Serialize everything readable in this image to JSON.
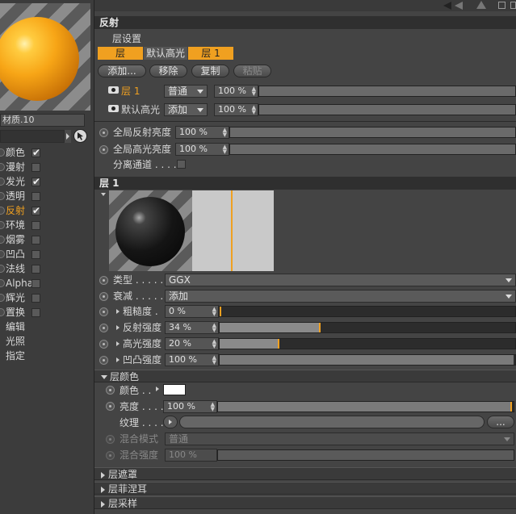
{
  "material_name": "材质.10",
  "channels": [
    {
      "label": "颜色",
      "checked": true,
      "active": false,
      "has_checkbox": true
    },
    {
      "label": "漫射",
      "checked": false,
      "active": false,
      "has_checkbox": true
    },
    {
      "label": "发光",
      "checked": true,
      "active": false,
      "has_checkbox": true
    },
    {
      "label": "透明",
      "checked": false,
      "active": false,
      "has_checkbox": true
    },
    {
      "label": "反射",
      "checked": true,
      "active": true,
      "has_checkbox": true
    },
    {
      "label": "环境",
      "checked": false,
      "active": false,
      "has_checkbox": true
    },
    {
      "label": "烟雾",
      "checked": false,
      "active": false,
      "has_checkbox": true
    },
    {
      "label": "凹凸",
      "checked": false,
      "active": false,
      "has_checkbox": true
    },
    {
      "label": "法线",
      "checked": false,
      "active": false,
      "has_checkbox": true
    },
    {
      "label": "Alpha",
      "checked": false,
      "active": false,
      "has_checkbox": true
    },
    {
      "label": "辉光",
      "checked": false,
      "active": false,
      "has_checkbox": true
    },
    {
      "label": "置换",
      "checked": false,
      "active": false,
      "has_checkbox": true
    },
    {
      "label": "编辑",
      "has_checkbox": false
    },
    {
      "label": "光照",
      "has_checkbox": false
    },
    {
      "label": "指定",
      "has_checkbox": false
    }
  ],
  "reflect": {
    "title": "反射",
    "layer_settings": "层设置",
    "tabs": [
      "层",
      "默认高光",
      "层 1"
    ],
    "buttons": {
      "add": "添加...",
      "remove": "移除",
      "copy": "复制",
      "paste": "粘贴"
    },
    "layers": [
      {
        "name": "层 1",
        "mode": "普通",
        "value": "100 %",
        "active": true
      },
      {
        "name": "默认高光",
        "mode": "添加",
        "value": "100 %",
        "active": false
      }
    ],
    "global_reflect": {
      "label": "全局反射亮度",
      "value": "100 %"
    },
    "global_spec": {
      "label": "全局高光亮度",
      "value": "100 %"
    },
    "separate_pass": {
      "label": "分离通道 . . . ."
    }
  },
  "layer1": {
    "title": "层 1",
    "type": {
      "label": "类型 . . . . . .",
      "value": "GGX"
    },
    "falloff": {
      "label": "衰减 . . . . . .",
      "value": "添加"
    },
    "roughness": {
      "label": "粗糙度 .",
      "value": "0 %",
      "fraction": 0.0
    },
    "reflect_strength": {
      "label": "反射强度",
      "value": "34 %",
      "fraction": 0.34
    },
    "spec_strength": {
      "label": "高光强度",
      "value": "20 %",
      "fraction": 0.2
    },
    "bump_strength": {
      "label": "凹凸强度",
      "value": "100 %",
      "fraction": 1.0
    }
  },
  "layer_color": {
    "title": "层颜色",
    "color": {
      "label": "颜色 . .",
      "swatch": "#ffffff"
    },
    "brightness": {
      "label": "亮度 . . . .",
      "value": "100 %",
      "fraction": 1.0
    },
    "texture": {
      "label": "纹理 . . . .",
      "browse": "..."
    },
    "blend_mode": {
      "label": "混合模式",
      "value": "普通"
    },
    "blend_strength": {
      "label": "混合强度",
      "value": "100 %"
    }
  },
  "collapsed_sections": [
    "层遮罩",
    "层菲涅耳",
    "层采样"
  ],
  "colors": {
    "accent": "#f0a020",
    "tab_active": "#f0a020",
    "background": "#444444",
    "header": "#2f2f2f"
  }
}
